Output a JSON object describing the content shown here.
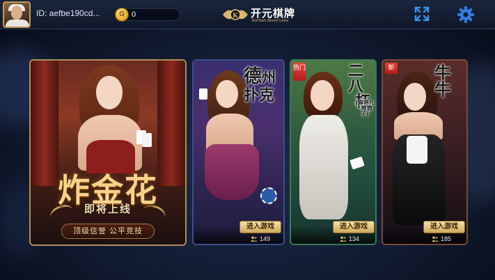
{
  "header": {
    "user_id": "ID: aefbe190cd...",
    "coins": "0",
    "coin_symbol": "G",
    "logo_title": "开元棋牌",
    "logo_subtitle": "KaiYuan Board Game",
    "fullscreen_icon": "fullscreen-icon",
    "settings_icon": "gear-icon"
  },
  "games": {
    "zjh": {
      "title": "炸金花",
      "subtitle": "即将上线",
      "banner": "顶级信誉 公平竞技"
    },
    "texas": {
      "title_chars": [
        "德",
        "州",
        "扑",
        "克"
      ],
      "enter_label": "进入游戏",
      "online": "149"
    },
    "erbagang": {
      "tag": "热门",
      "title_chars": [
        "二",
        "八",
        "杠"
      ],
      "subtitle": "(麻将九 · 推筒子)",
      "enter_label": "进入游戏",
      "online": "134"
    },
    "niuniu": {
      "tag": "新",
      "title_chars": [
        "牛",
        "牛"
      ],
      "enter_label": "进入游戏",
      "online": "185"
    }
  },
  "colors": {
    "accent_gold": "#f7d38a",
    "settings_blue": "#2f7de0"
  }
}
